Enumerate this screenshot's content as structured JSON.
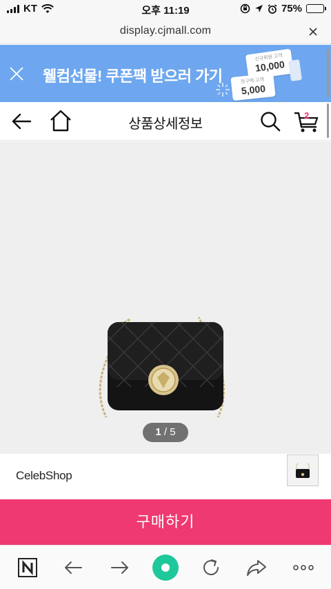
{
  "status_bar": {
    "carrier": "KT",
    "time": "오후 11:19",
    "battery": "75%",
    "battery_level": 0.75
  },
  "url_bar": {
    "url": "display.cjmall.com"
  },
  "promo_banner": {
    "text": "웰컴선물! 쿠폰팩 받으러 가기",
    "coupon_top_caption": "신규회원 고객",
    "coupon_top_amount": "10,000",
    "coupon_bottom_caption": "첫구매 고객",
    "coupon_bottom_amount": "5,000",
    "background_color": "#6ea7ef"
  },
  "header": {
    "title": "상품상세정보",
    "cart_count": "2",
    "icons": [
      "back-arrow-icon",
      "home-icon",
      "search-icon",
      "cart-icon"
    ]
  },
  "product_image": {
    "pager_current": "1",
    "pager_separator": "/",
    "pager_total": "5"
  },
  "seller": {
    "name": "CelebShop"
  },
  "buy_button": {
    "label": "구매하기",
    "color": "#ef3971"
  },
  "bottom_toolbar": {
    "icons": [
      "naver-n-icon",
      "back-icon",
      "forward-icon",
      "green-home-icon",
      "refresh-icon",
      "share-icon",
      "more-icon"
    ],
    "accent_color": "#1ec89a"
  }
}
